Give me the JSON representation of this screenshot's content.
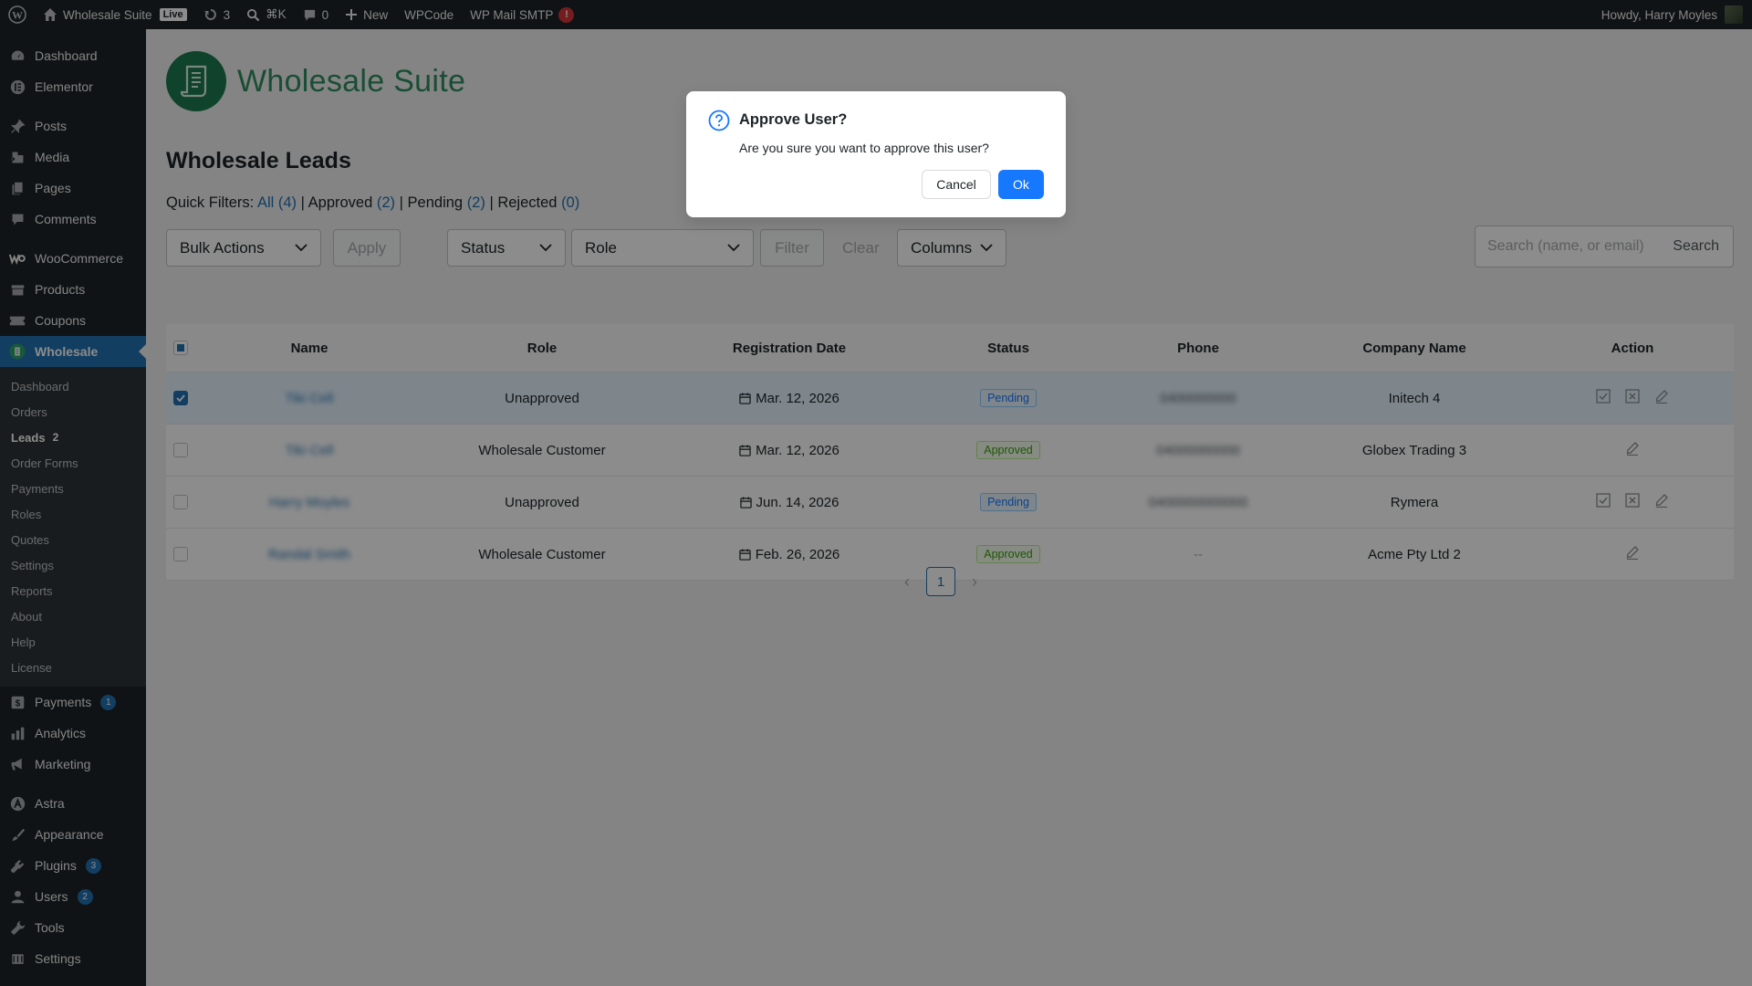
{
  "admin_bar": {
    "site_name": "Wholesale Suite",
    "live_label": "Live",
    "updates_count": "3",
    "search_shortcut": "⌘K",
    "comments_count": "0",
    "new_label": "New",
    "wpcode_label": "WPCode",
    "wp_mail_smtp_label": "WP Mail SMTP",
    "wp_mail_smtp_alert": "!",
    "greeting": "Howdy, Harry Moyles"
  },
  "sidebar": {
    "top_items": [
      {
        "label": "Dashboard",
        "icon": "dashboard-icon"
      },
      {
        "label": "Elementor",
        "icon": "elementor-icon"
      }
    ],
    "content_items": [
      {
        "label": "Posts",
        "icon": "pin-icon"
      },
      {
        "label": "Media",
        "icon": "media-icon"
      },
      {
        "label": "Pages",
        "icon": "pages-icon"
      },
      {
        "label": "Comments",
        "icon": "comments-icon"
      }
    ],
    "shop_items": [
      {
        "label": "WooCommerce",
        "icon": "woocommerce-icon"
      },
      {
        "label": "Products",
        "icon": "products-icon"
      },
      {
        "label": "Coupons",
        "icon": "coupons-icon"
      }
    ],
    "active_item": {
      "label": "Wholesale",
      "icon": "wholesale-icon"
    },
    "submenu": [
      {
        "label": "Dashboard"
      },
      {
        "label": "Orders"
      },
      {
        "label": "Leads",
        "count": "2"
      },
      {
        "label": "Order Forms"
      },
      {
        "label": "Payments"
      },
      {
        "label": "Roles"
      },
      {
        "label": "Quotes"
      },
      {
        "label": "Settings"
      },
      {
        "label": "Reports"
      },
      {
        "label": "About"
      },
      {
        "label": "Help"
      },
      {
        "label": "License"
      }
    ],
    "bottom_items_a": [
      {
        "label": "Payments",
        "icon": "payments-icon",
        "badge": "1"
      },
      {
        "label": "Analytics",
        "icon": "analytics-icon"
      },
      {
        "label": "Marketing",
        "icon": "marketing-icon"
      }
    ],
    "bottom_items_b": [
      {
        "label": "Astra",
        "icon": "astra-icon"
      },
      {
        "label": "Appearance",
        "icon": "appearance-icon"
      },
      {
        "label": "Plugins",
        "icon": "plugins-icon",
        "badge": "3"
      },
      {
        "label": "Users",
        "icon": "users-icon",
        "badge": "2"
      },
      {
        "label": "Tools",
        "icon": "tools-icon"
      },
      {
        "label": "Settings",
        "icon": "settings-icon"
      }
    ]
  },
  "main": {
    "logo_text": "Wholesale Suite",
    "page_title": "Wholesale Leads",
    "quick_filters": {
      "label": "Quick Filters:",
      "all": "All",
      "all_count": "(4)",
      "approved": "Approved",
      "approved_count": "(2)",
      "pending": "Pending",
      "pending_count": "(2)",
      "rejected": "Rejected",
      "rejected_count": "(0)",
      "separator": "|"
    },
    "toolbar": {
      "bulk_actions": "Bulk Actions",
      "apply": "Apply",
      "status": "Status",
      "role": "Role",
      "filter": "Filter",
      "clear": "Clear",
      "columns": "Columns",
      "search_placeholder": "Search (name, or email)",
      "search_button": "Search"
    },
    "table": {
      "columns": [
        "Name",
        "Role",
        "Registration Date",
        "Status",
        "Phone",
        "Company Name",
        "Action"
      ],
      "rows": [
        {
          "name": "Tiki Cell",
          "role": "Unapproved",
          "date": "Mar. 12, 2026",
          "status": "Pending",
          "phone": "0400000000",
          "company": "Initech 4",
          "selected": true
        },
        {
          "name": "Tiki Cell",
          "role": "Wholesale Customer",
          "date": "Mar. 12, 2026",
          "status": "Approved",
          "phone": "04000000000",
          "company": "Globex Trading 3",
          "selected": false
        },
        {
          "name": "Harry Moyles",
          "role": "Unapproved",
          "date": "Jun. 14, 2026",
          "status": "Pending",
          "phone": "0400000000000",
          "company": "Rymera",
          "selected": false
        },
        {
          "name": "Randal Smith",
          "role": "Wholesale Customer",
          "date": "Feb. 26, 2026",
          "status": "Approved",
          "phone": "--",
          "company": "Acme Pty Ltd 2",
          "selected": false
        }
      ]
    },
    "pagination": {
      "prev": "‹",
      "current": "1",
      "next": "›"
    }
  },
  "modal": {
    "title": "Approve User?",
    "body": "Are you sure you want to approve this user?",
    "cancel": "Cancel",
    "ok": "Ok"
  },
  "colors": {
    "admin_bg": "#1d2327",
    "accent": "#2271b1",
    "primary_button": "#1677ff",
    "pending_tag": "#1677ff",
    "approved_tag": "#389e0d",
    "brand_green": "#1d7a4f"
  }
}
